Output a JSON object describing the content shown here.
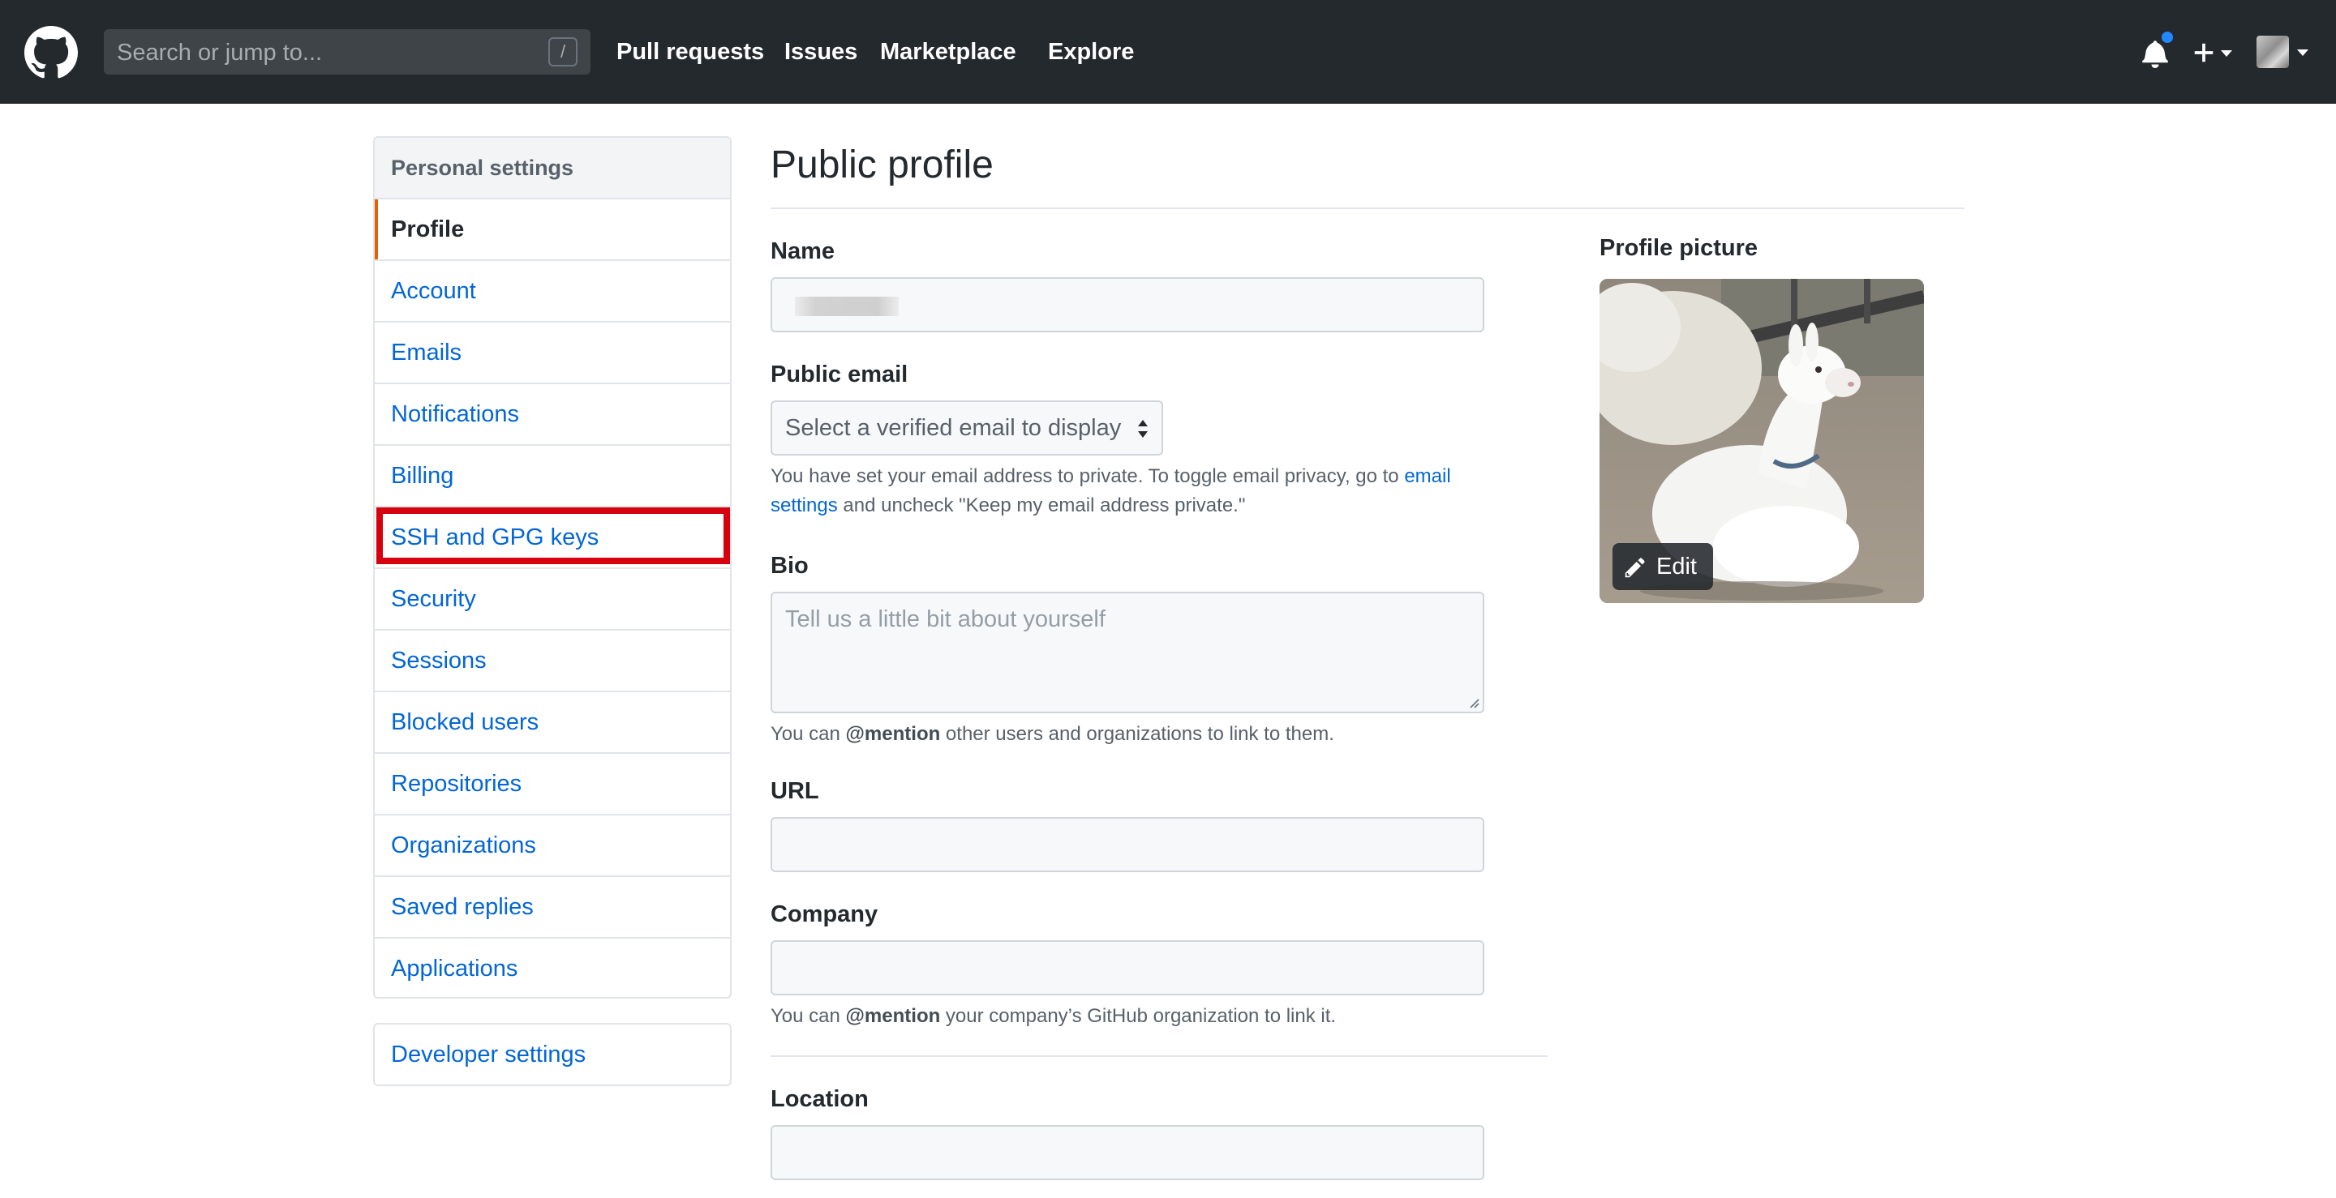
{
  "header": {
    "logo_icon": "github-octocat-icon",
    "search": {
      "placeholder": "Search or jump to...",
      "shortcut": "/"
    },
    "nav": [
      "Pull requests",
      "Issues",
      "Marketplace",
      "Explore"
    ],
    "notifications_icon": "bell-icon",
    "notification_dot_color": "#2188ff",
    "create_icon": "plus-icon",
    "avatar_icon": "avatar"
  },
  "sidebar": {
    "heading": "Personal settings",
    "items": [
      {
        "label": "Profile",
        "selected": true
      },
      {
        "label": "Account"
      },
      {
        "label": "Emails"
      },
      {
        "label": "Notifications"
      },
      {
        "label": "Billing"
      },
      {
        "label": "SSH and GPG keys",
        "highlighted": true
      },
      {
        "label": "Security"
      },
      {
        "label": "Sessions"
      },
      {
        "label": "Blocked users"
      },
      {
        "label": "Repositories"
      },
      {
        "label": "Organizations"
      },
      {
        "label": "Saved replies"
      },
      {
        "label": "Applications"
      }
    ],
    "developer_settings": "Developer settings",
    "accent_color": "#e36209",
    "link_color": "#0366d6",
    "highlight_color": "#d7000f"
  },
  "main": {
    "title": "Public profile",
    "name": {
      "label": "Name",
      "value": ""
    },
    "public_email": {
      "label": "Public email",
      "selected": "Select a verified email to display",
      "note_prefix": "You have set your email address to private. To toggle email privacy, go to ",
      "note_link": "email settings",
      "note_suffix": " and uncheck \"Keep my email address private.\""
    },
    "bio": {
      "label": "Bio",
      "placeholder": "Tell us a little bit about yourself",
      "note_prefix": "You can ",
      "note_mention": "@mention",
      "note_suffix": " other users and organizations to link to them."
    },
    "url": {
      "label": "URL",
      "value": ""
    },
    "company": {
      "label": "Company",
      "value": "",
      "note_prefix": "You can ",
      "note_mention": "@mention",
      "note_suffix": " your company’s GitHub organization to link it."
    },
    "location": {
      "label": "Location",
      "value": ""
    }
  },
  "profile_picture": {
    "label": "Profile picture",
    "image_icon": "alpaca-photo",
    "edit_label": "Edit",
    "edit_icon": "pencil-icon"
  }
}
